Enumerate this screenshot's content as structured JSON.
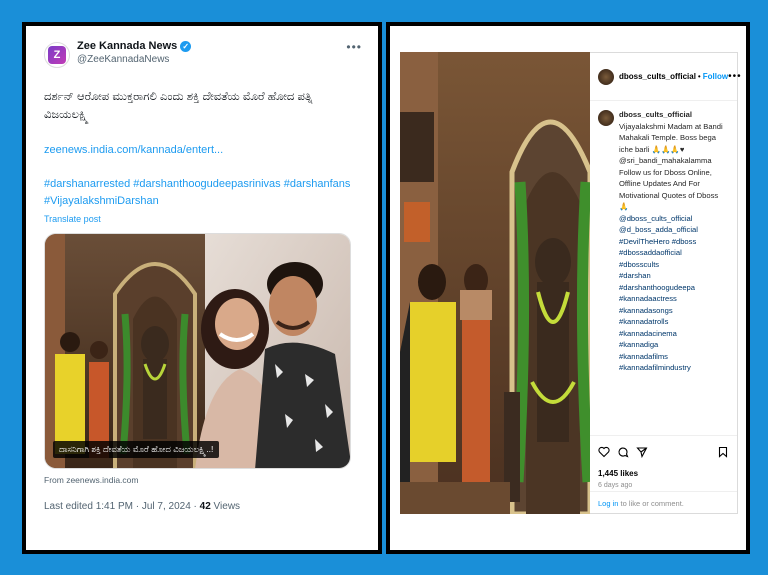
{
  "tweet": {
    "account_name": "Zee Kannada News",
    "handle": "@ZeeKannadaNews",
    "avatar_letter": "Z",
    "text": "ದರ್ಶನ್ ಆರೋಪ ಮುಕ್ತರಾಗಲಿ ಎಂದು ಶಕ್ತಿ ದೇವತೆಯ ಮೊರೆ ಹೋದ ಪತ್ನಿ ವಿಜಯಲಕ್ಷ್ಮಿ",
    "link": "zeenews.india.com/kannada/entert...",
    "hashtags": "#darshanarrested #darshanthoogudeepasrinivas #darshanfans #VijayalakshmiDarshan",
    "translate": "Translate post",
    "image_caption": "ದಾಸನಿಗಾಗಿ ಶಕ್ತಿ ದೇವತೆಯ ಮೊರೆ ಹೋದ ವಿಜಯಲಕ್ಷ್ಮಿ..!",
    "source": "From zeenews.india.com",
    "meta_prefix": "Last edited 1:41 PM · Jul 7, 2024 · ",
    "views_count": "42",
    "views_label": " Views",
    "colors": {
      "link": "#1d9bf0",
      "verified": "#1d9bf0"
    }
  },
  "instagram": {
    "username": "dboss_cults_official",
    "follow_label": "Follow",
    "caption_user": "dboss_cults_official",
    "caption_text": " Vijayalakshmi Madam at Bandi Mahakali Temple. Boss bega iche barli 🙏🙏🙏♥",
    "caption_text2": "@sri_bandi_mahakalamma Follow us for Dboss Online, Offline Updates And For Motivational Quotes of Dboss 🙏",
    "tags": [
      "@dboss_cults_official",
      "@d_boss_adda_official",
      "#DevilTheHero #dboss",
      "#dbossaddaofficial",
      "#dbosscults",
      "#darshan",
      "#darshanthoogudeepa",
      "#kannadaactress",
      "#kannadasongs",
      "#kannadatrolls",
      "#kannadacinema",
      "#kannadiga",
      "#kannadafilms",
      "#kannadafilmindustry"
    ],
    "likes": "1,445 likes",
    "posted": "6 days ago",
    "login_link": "Log in",
    "login_text": " to like or comment.",
    "colors": {
      "follow": "#0095f6",
      "tag": "#00376b"
    }
  },
  "icons": [
    "more-icon",
    "verified-icon",
    "heart-icon",
    "comment-icon",
    "share-icon",
    "save-icon"
  ],
  "colors": {
    "background": "#1a8fd8",
    "frame": "#000000"
  }
}
